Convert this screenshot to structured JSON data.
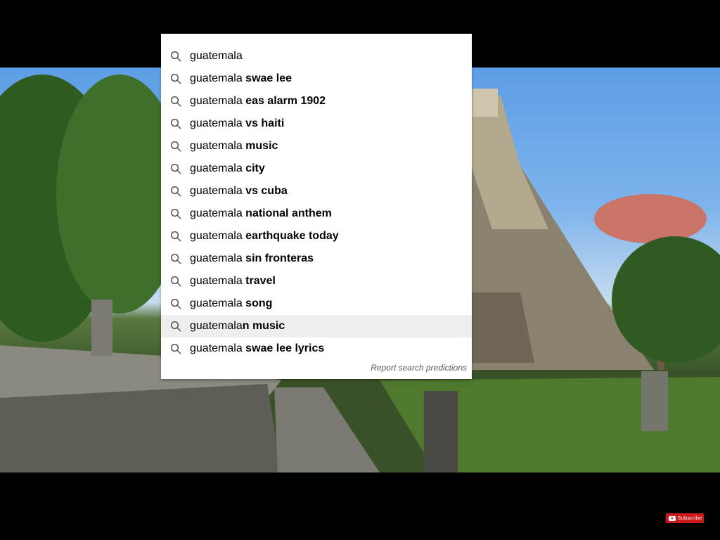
{
  "search": {
    "query": "guatemala",
    "suggestions": [
      {
        "query": "guatemala",
        "completion": ""
      },
      {
        "query": "guatemala",
        "completion": " swae lee"
      },
      {
        "query": "guatemala",
        "completion": " eas alarm 1902"
      },
      {
        "query": "guatemala",
        "completion": " vs haiti"
      },
      {
        "query": "guatemala",
        "completion": " music"
      },
      {
        "query": "guatemala",
        "completion": " city"
      },
      {
        "query": "guatemala",
        "completion": " vs cuba"
      },
      {
        "query": "guatemala",
        "completion": " national anthem"
      },
      {
        "query": "guatemala",
        "completion": " earthquake today"
      },
      {
        "query": "guatemala",
        "completion": " sin fronteras"
      },
      {
        "query": "guatemala",
        "completion": " travel"
      },
      {
        "query": "guatemala",
        "completion": " song"
      },
      {
        "query": "guatemala",
        "completion": "n music"
      },
      {
        "query": "guatemala",
        "completion": " swae lee lyrics"
      }
    ],
    "highlighted_index": 12,
    "report_label": "Report search predictions",
    "icon": "search-icon"
  },
  "video": {
    "subscribe_label": "Subscribe"
  },
  "colors": {
    "panel_bg": "#ffffff",
    "highlight_bg": "#eeeeee",
    "subscribe_red": "#cc1a1a"
  }
}
